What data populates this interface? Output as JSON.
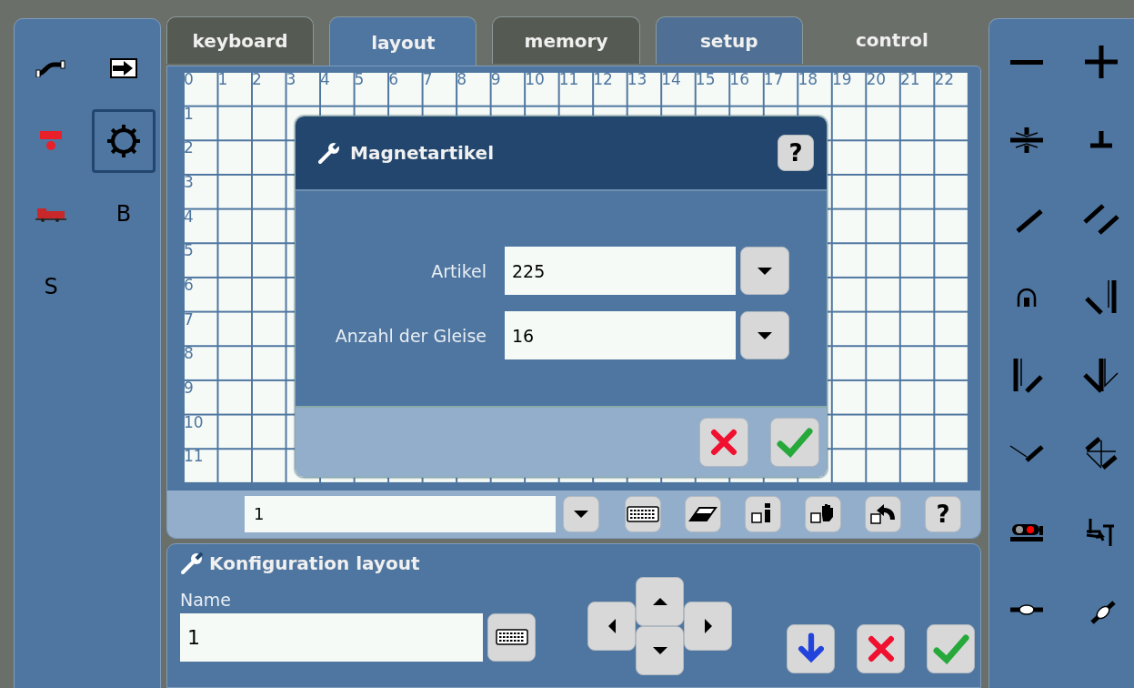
{
  "left_panel": {
    "items": [
      {
        "kind": "pipe",
        "selected": false
      },
      {
        "kind": "exit",
        "selected": false
      },
      {
        "kind": "signal",
        "selected": false
      },
      {
        "kind": "gear",
        "selected": true
      },
      {
        "kind": "loco",
        "selected": false
      },
      {
        "kind": "letter",
        "text": "B",
        "selected": false
      },
      {
        "kind": "letter",
        "text": "S",
        "selected": false
      }
    ]
  },
  "tabs": [
    {
      "label": "keyboard",
      "kind": "dark",
      "selected": false
    },
    {
      "label": "layout",
      "kind": "blue",
      "selected": true
    },
    {
      "label": "memory",
      "kind": "dark",
      "selected": false
    },
    {
      "label": "setup",
      "kind": "blue",
      "selected": false
    },
    {
      "label": "control",
      "kind": "flat",
      "selected": false
    }
  ],
  "grid": {
    "columns": [
      "0",
      "1",
      "2",
      "3",
      "4",
      "5",
      "6",
      "7",
      "8",
      "9",
      "10",
      "11",
      "12",
      "13",
      "14",
      "15",
      "16",
      "17",
      "18",
      "19",
      "20",
      "21",
      "22"
    ],
    "rows": [
      "1",
      "2",
      "3",
      "4",
      "5",
      "6",
      "7",
      "8",
      "9",
      "10",
      "11"
    ]
  },
  "dialog": {
    "title": "Magnetartikel",
    "help": "?",
    "fields": [
      {
        "label": "Artikel",
        "value": "225"
      },
      {
        "label": "Anzahl der Gleise",
        "value": "16"
      }
    ],
    "buttons": [
      {
        "kind": "cancel"
      },
      {
        "kind": "ok"
      }
    ]
  },
  "toolbar": {
    "value": "1",
    "tools": [
      {
        "kind": "keyboard"
      },
      {
        "kind": "eraser"
      },
      {
        "kind": "info"
      },
      {
        "kind": "hand"
      },
      {
        "kind": "undo"
      },
      {
        "kind": "help",
        "text": "?"
      }
    ]
  },
  "config": {
    "title": "Konfiguration layout",
    "name_label": "Name",
    "name_value": "1",
    "buttons": [
      {
        "kind": "down"
      },
      {
        "kind": "cancel"
      },
      {
        "kind": "ok"
      }
    ]
  },
  "right_panel": {
    "tools": [
      {
        "kind": "minus"
      },
      {
        "kind": "plus"
      },
      {
        "kind": "isolator"
      },
      {
        "kind": "bumper"
      },
      {
        "kind": "diagonal"
      },
      {
        "kind": "double"
      },
      {
        "kind": "tunnel"
      },
      {
        "kind": "left"
      },
      {
        "kind": "right"
      },
      {
        "kind": "threeway"
      },
      {
        "kind": "curve"
      },
      {
        "kind": "crossing"
      },
      {
        "kind": "signal"
      },
      {
        "kind": "decoupler"
      },
      {
        "kind": "detector"
      },
      {
        "kind": "slant"
      }
    ]
  }
}
